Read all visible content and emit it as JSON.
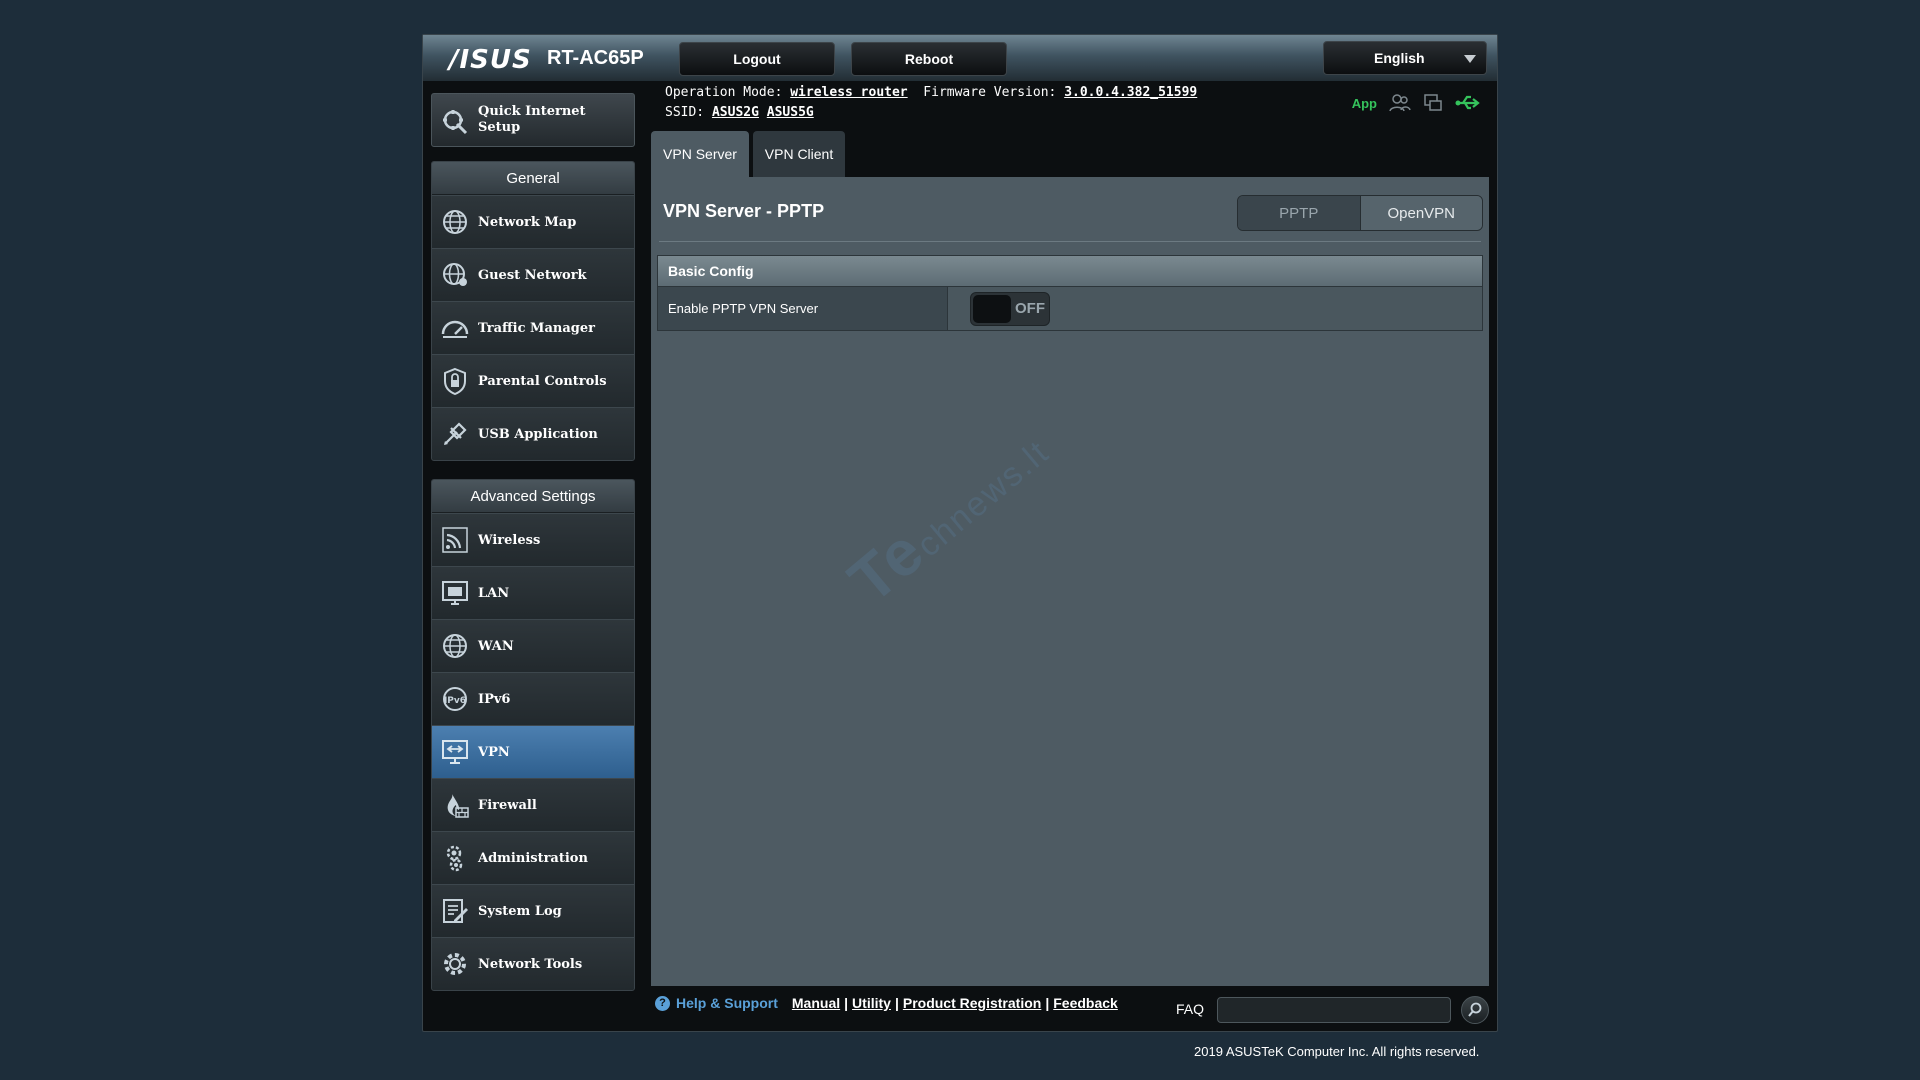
{
  "header": {
    "logo": "/ISUS",
    "model": "RT-AC65P",
    "logout_label": "Logout",
    "reboot_label": "Reboot",
    "language": "English"
  },
  "info": {
    "operation_mode_label": "Operation Mode:",
    "operation_mode_value": "wireless router",
    "firmware_label": "Firmware Version:",
    "firmware_value": "3.0.0.4.382_51599",
    "ssid_label": "SSID:",
    "ssid_1": "ASUS2G",
    "ssid_2": "ASUS5G",
    "app_label": "App"
  },
  "sidebar": {
    "quick_setup": "Quick Internet Setup",
    "general_title": "General",
    "general_items": [
      {
        "label": "Network Map",
        "icon": "network-map-icon"
      },
      {
        "label": "Guest Network",
        "icon": "guest-network-icon"
      },
      {
        "label": "Traffic Manager",
        "icon": "traffic-manager-icon"
      },
      {
        "label": "Parental Controls",
        "icon": "parental-controls-icon"
      },
      {
        "label": "USB Application",
        "icon": "usb-application-icon"
      }
    ],
    "advanced_title": "Advanced Settings",
    "advanced_items": [
      {
        "label": "Wireless",
        "icon": "wireless-icon"
      },
      {
        "label": "LAN",
        "icon": "lan-icon"
      },
      {
        "label": "WAN",
        "icon": "wan-icon"
      },
      {
        "label": "IPv6",
        "icon": "ipv6-icon"
      },
      {
        "label": "VPN",
        "icon": "vpn-icon",
        "active": true
      },
      {
        "label": "Firewall",
        "icon": "firewall-icon"
      },
      {
        "label": "Administration",
        "icon": "administration-icon"
      },
      {
        "label": "System Log",
        "icon": "system-log-icon"
      },
      {
        "label": "Network Tools",
        "icon": "network-tools-icon"
      }
    ]
  },
  "tabs": [
    {
      "label": "VPN Server",
      "active": true
    },
    {
      "label": "VPN Client",
      "active": false
    }
  ],
  "main": {
    "title": "VPN Server - PPTP",
    "segment_pptp": "PPTP",
    "segment_openvpn": "OpenVPN",
    "section_title": "Basic Config",
    "row_label": "Enable PPTP VPN Server",
    "toggle_state": "OFF",
    "watermark": "Te",
    "watermark_rest": "chnews.lt"
  },
  "footer": {
    "help_label": "Help & Support",
    "manual": "Manual",
    "utility": "Utility",
    "product_registration": "Product Registration",
    "feedback": "Feedback",
    "faq_label": "FAQ",
    "copyright": "2019 ASUSTeK Computer Inc. All rights reserved."
  },
  "colors": {
    "active_menu": "#3a6fa0",
    "app_green": "#35c35c",
    "help_blue": "#5aa0d8"
  }
}
